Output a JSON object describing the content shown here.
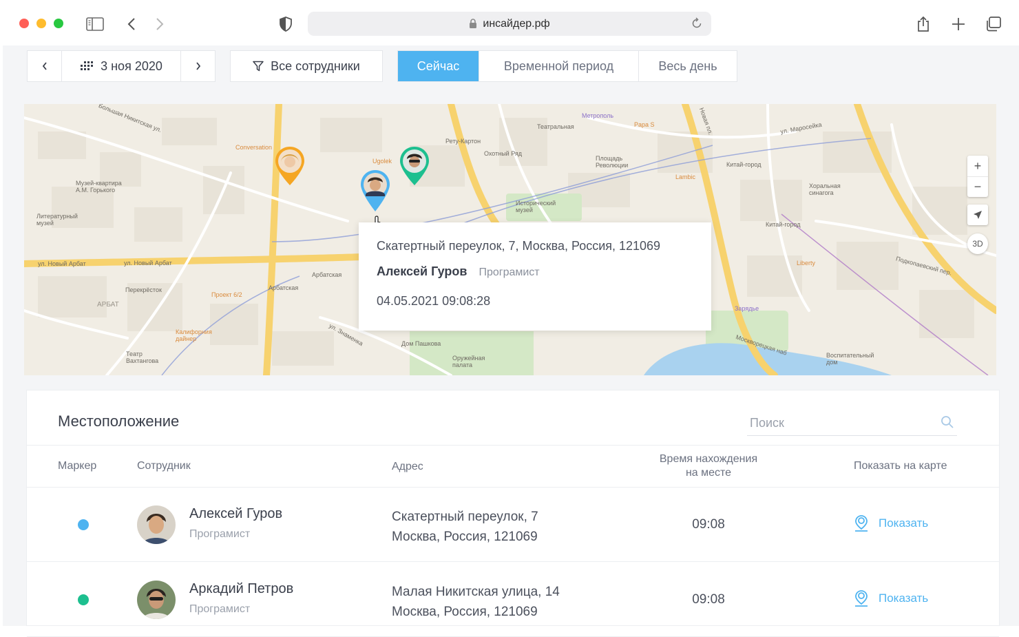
{
  "browser": {
    "url": "инсайдер.рф",
    "colors": {
      "close": "#ff5f57",
      "minimize": "#febc2e",
      "maximize": "#28c840"
    }
  },
  "toolbar": {
    "date": "3 ноя 2020",
    "filter": "Все сотрудники",
    "modes": [
      "Сейчас",
      "Временной период",
      "Весь день"
    ],
    "active_mode": "Сейчас",
    "accent": "#4eb3f0"
  },
  "map": {
    "labels": {
      "l1": "Большая Никитская ул.",
      "l2": "ул. Новый Арбат",
      "l3": "ул. Новый Арбат",
      "l4": "Охотный Ряд",
      "l5": "Театральная",
      "l6": "Площадь Революции",
      "l7": "Китай-город",
      "l8": "Китай-город",
      "l9": "Арбатская",
      "l10": "Арбатская",
      "l11": "ул. Знаменка",
      "l12": "Москворецкая наб",
      "l13": "ул. Маросейка",
      "l14": "АРБАТ",
      "l15": "Музей-квартира А.М. Горького",
      "l16": "Литературный музей",
      "l17": "Conversation",
      "l18": "Исторический музей",
      "l19": "Калифорния дайнер",
      "l20": "Театр Вахтангова",
      "l21": "Дом Пашкова",
      "l22": "Оружейная палата",
      "l23": "Хоральная синагога",
      "l24": "Papa S",
      "l25": "Lambic",
      "l26": "Liberty",
      "l27": "Перекрёсток",
      "l28": "Проект 6/2",
      "l29": "Метрополь",
      "l30": "Ugolek",
      "l31": "Рету-Картон",
      "l32": "Подкопаевский пер.",
      "l33": "Новая пл.",
      "l34": "Зарядье",
      "l35": "Воспитательный дом"
    },
    "zoom_in": "+",
    "zoom_out": "−",
    "btn_3d": "3D"
  },
  "tooltip": {
    "address": "Скатертный переулок, 7, Москва, Россия, 121069",
    "name": "Алексей Гуров",
    "role": "Програмист",
    "datetime": "04.05.2021 09:08:28"
  },
  "panel": {
    "title": "Местоположение",
    "search_placeholder": "Поиск",
    "columns": {
      "marker": "Маркер",
      "employee": "Сотрудник",
      "address": "Адрес",
      "time_line1": "Время нахождения",
      "time_line2": "на месте",
      "show": "Показать на карте"
    },
    "rows": [
      {
        "marker_color": "#4eb3f0",
        "name": "Алексей Гуров",
        "role": "Програмист",
        "address_line1": "Скатертный переулок, 7",
        "address_line2": "Москва, Россия, 121069",
        "time": "09:08",
        "action": "Показать"
      },
      {
        "marker_color": "#1dbf8f",
        "name": "Аркадий Петров",
        "role": "Програмист",
        "address_line1": "Малая Никитская улица, 14",
        "address_line2": "Москва, Россия, 121069",
        "time": "09:08",
        "action": "Показать"
      }
    ]
  },
  "pins": {
    "yellow": "#f5a623",
    "blue": "#4eb3f0",
    "green": "#1dbf8f"
  }
}
